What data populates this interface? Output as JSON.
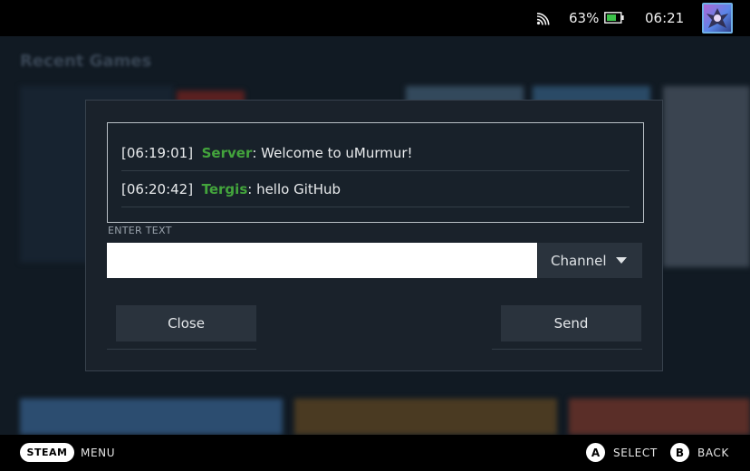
{
  "status_bar": {
    "battery_percent": "63%",
    "clock": "06:21",
    "icons": [
      "wifi-icon",
      "battery-icon",
      "avatar"
    ]
  },
  "background": {
    "title": "Recent Games"
  },
  "dialog": {
    "messages": [
      {
        "time": "[06:19:01]",
        "user": "Server",
        "text": ": Welcome to uMurmur!"
      },
      {
        "time": "[06:20:42]",
        "user": "Tergis",
        "text": ": hello GitHub"
      }
    ],
    "input_label": "ENTER TEXT",
    "input_value": "",
    "channel_label": "Channel",
    "close_label": "Close",
    "send_label": "Send"
  },
  "bottom_bar": {
    "steam_label": "STEAM",
    "menu_label": "MENU",
    "a_glyph": "A",
    "select_label": "SELECT",
    "b_glyph": "B",
    "back_label": "BACK"
  },
  "colors": {
    "username": "#43a43c",
    "panel": "#1a222b",
    "button": "#2a333d"
  }
}
